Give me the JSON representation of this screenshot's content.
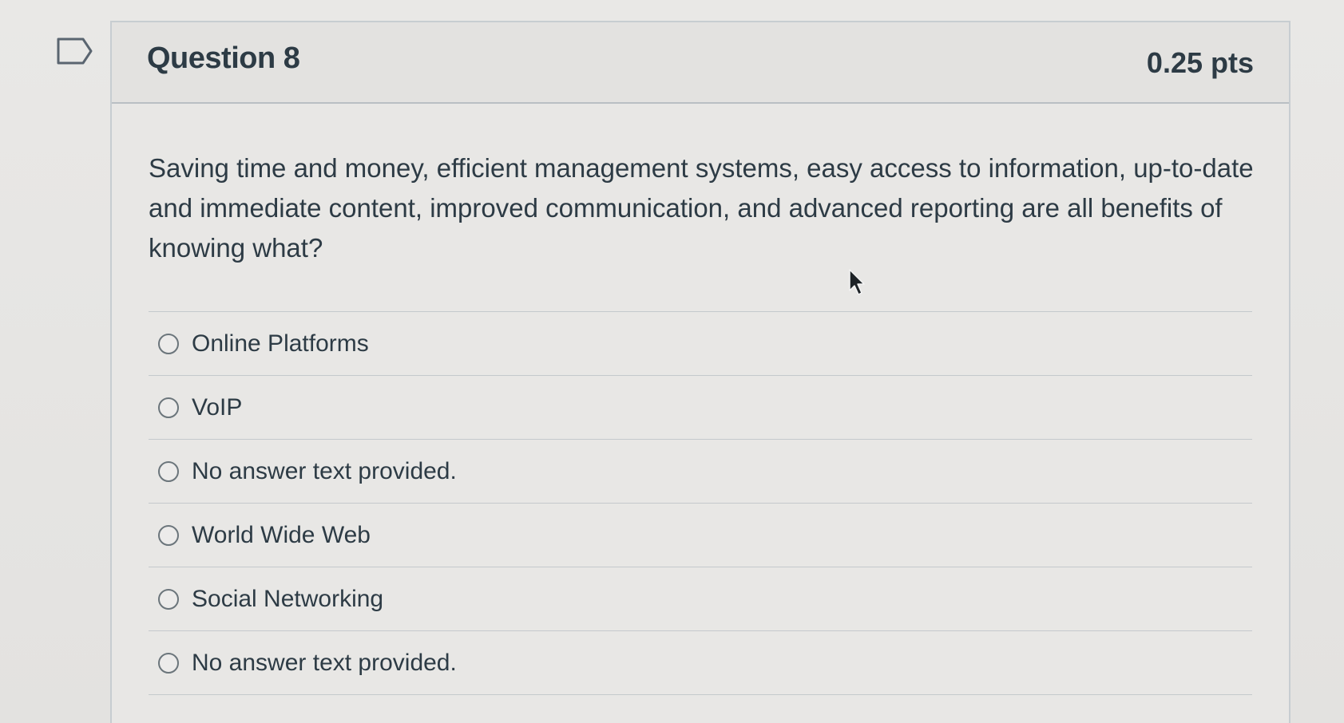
{
  "question": {
    "title": "Question 8",
    "points": "0.25 pts",
    "text": "Saving time and money, efficient management systems, easy access to information, up-to-date and immediate content, improved communication, and advanced reporting are all benefits of knowing what?"
  },
  "answers": [
    {
      "label": "Online Platforms",
      "selected": false
    },
    {
      "label": "VoIP",
      "selected": false
    },
    {
      "label": "No answer text provided.",
      "selected": false
    },
    {
      "label": "World Wide Web",
      "selected": false
    },
    {
      "label": "Social Networking",
      "selected": false
    },
    {
      "label": "No answer text provided.",
      "selected": false
    }
  ],
  "icons": {
    "flag": "flag-question-icon",
    "cursor": "mouse-pointer-icon"
  }
}
